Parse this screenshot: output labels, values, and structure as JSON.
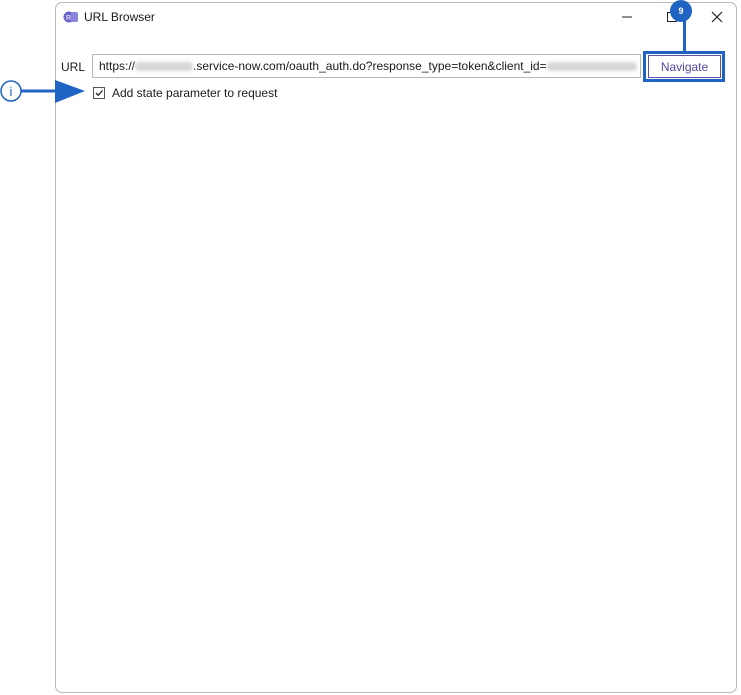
{
  "window": {
    "title": "URL Browser",
    "app_icon": "app-icon"
  },
  "controls": {
    "minimize": "minimize-icon",
    "maximize": "maximize-icon",
    "close": "close-icon"
  },
  "url": {
    "label": "URL",
    "value_prefix": "https://",
    "value_middle": ".service-now.com/oauth_auth.do?response_type=token&client_id="
  },
  "navigate_label": "Navigate",
  "checkbox": {
    "label": "Add state parameter to request",
    "checked": true
  },
  "annotation": {
    "badge": "9",
    "info": "i"
  },
  "colors": {
    "accent": "#1f63c3",
    "button_text": "#4f4a9e"
  }
}
